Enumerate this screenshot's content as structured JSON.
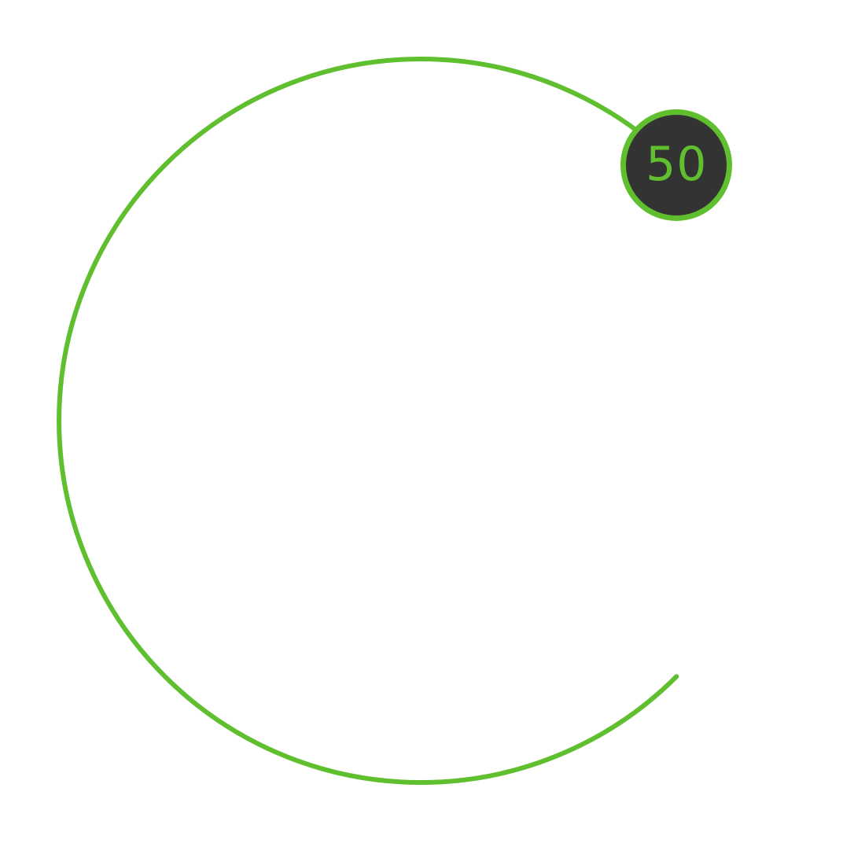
{
  "dial": {
    "value": "50",
    "level": 0.5,
    "accent_color": "#5fbf2f",
    "knob_color": "#333333",
    "background_color": "#ffffff"
  }
}
